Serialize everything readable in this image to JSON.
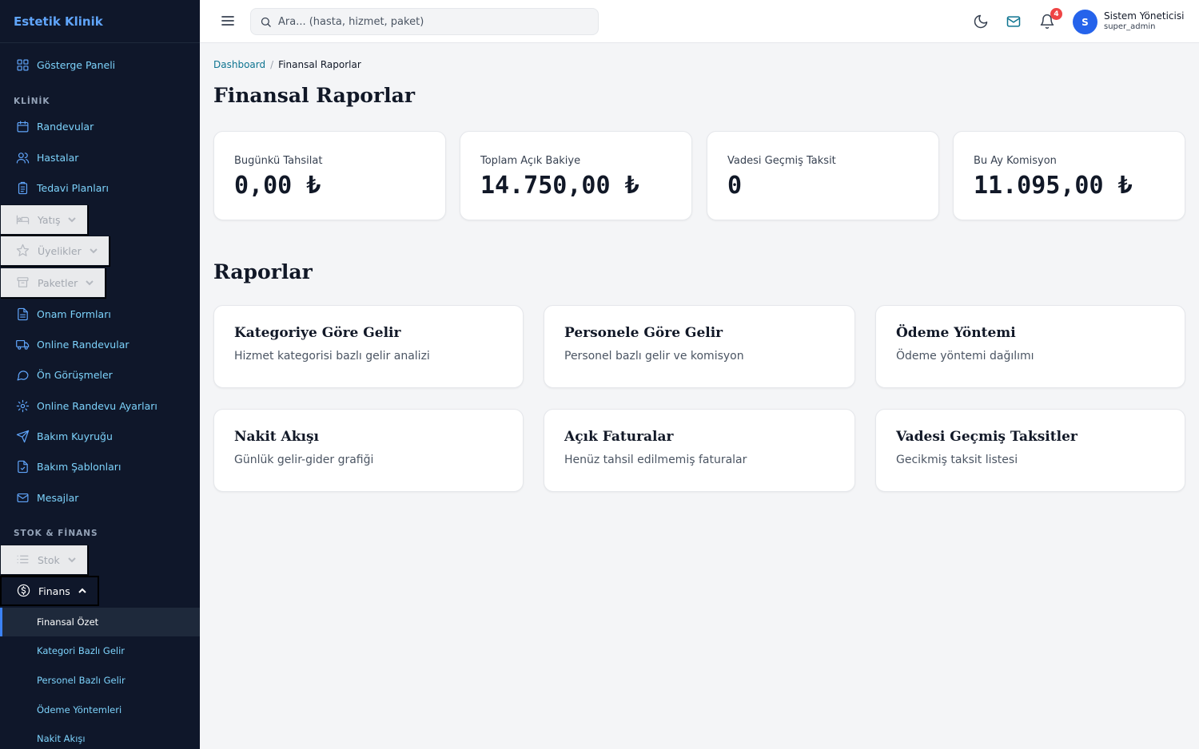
{
  "brand": "Estetik Klinik",
  "sidebar": {
    "dashboard": "Gösterge Paneli",
    "section_klinik": "KLİNİK",
    "section_stok": "STOK & FİNANS",
    "items": {
      "randevular": "Randevular",
      "hastalar": "Hastalar",
      "tedavi": "Tedavi Planları",
      "yatis": "Yatış",
      "uyelikler": "Üyelikler",
      "paketler": "Paketler",
      "onam": "Onam Formları",
      "online_randevular": "Online Randevular",
      "on_gorusmeler": "Ön Görüşmeler",
      "online_ayarlar": "Online Randevu Ayarları",
      "bakim_kuyrugu": "Bakım Kuyruğu",
      "bakim_sablonlari": "Bakım Şablonları",
      "mesajlar": "Mesajlar",
      "stok": "Stok",
      "finans": "Finans"
    },
    "finans_sub": {
      "ozet": "Finansal Özet",
      "kategori": "Kategori Bazlı Gelir",
      "personel": "Personel Bazlı Gelir",
      "odeme": "Ödeme Yöntemleri",
      "nakit": "Nakit Akışı"
    }
  },
  "topbar": {
    "search_placeholder": "Ara... (hasta, hizmet, paket)",
    "notification_count": "4",
    "avatar_initial": "S",
    "user_name": "Sistem Yöneticisi",
    "user_role": "super_admin"
  },
  "breadcrumb": {
    "home": "Dashboard",
    "separator": "/",
    "current": "Finansal Raporlar"
  },
  "page_title": "Finansal Raporlar",
  "stats": [
    {
      "label": "Bugünkü Tahsilat",
      "value": "0,00 ₺"
    },
    {
      "label": "Toplam Açık Bakiye",
      "value": "14.750,00 ₺"
    },
    {
      "label": "Vadesi Geçmiş Taksit",
      "value": "0"
    },
    {
      "label": "Bu Ay Komisyon",
      "value": "11.095,00 ₺"
    }
  ],
  "reports_title": "Raporlar",
  "reports": [
    {
      "title": "Kategoriye Göre Gelir",
      "desc": "Hizmet kategorisi bazlı gelir analizi"
    },
    {
      "title": "Personele Göre Gelir",
      "desc": "Personel bazlı gelir ve komisyon"
    },
    {
      "title": "Ödeme Yöntemi",
      "desc": "Ödeme yöntemi dağılımı"
    },
    {
      "title": "Nakit Akışı",
      "desc": "Günlük gelir-gider grafiği"
    },
    {
      "title": "Açık Faturalar",
      "desc": "Henüz tahsil edilmemiş faturalar"
    },
    {
      "title": "Vadesi Geçmiş Taksitler",
      "desc": "Gecikmiş taksit listesi"
    }
  ],
  "colors": {
    "sidebar_bg": "#0f172a",
    "accent": "#3b82f6",
    "link": "#0e7490",
    "badge": "#ef4444"
  }
}
